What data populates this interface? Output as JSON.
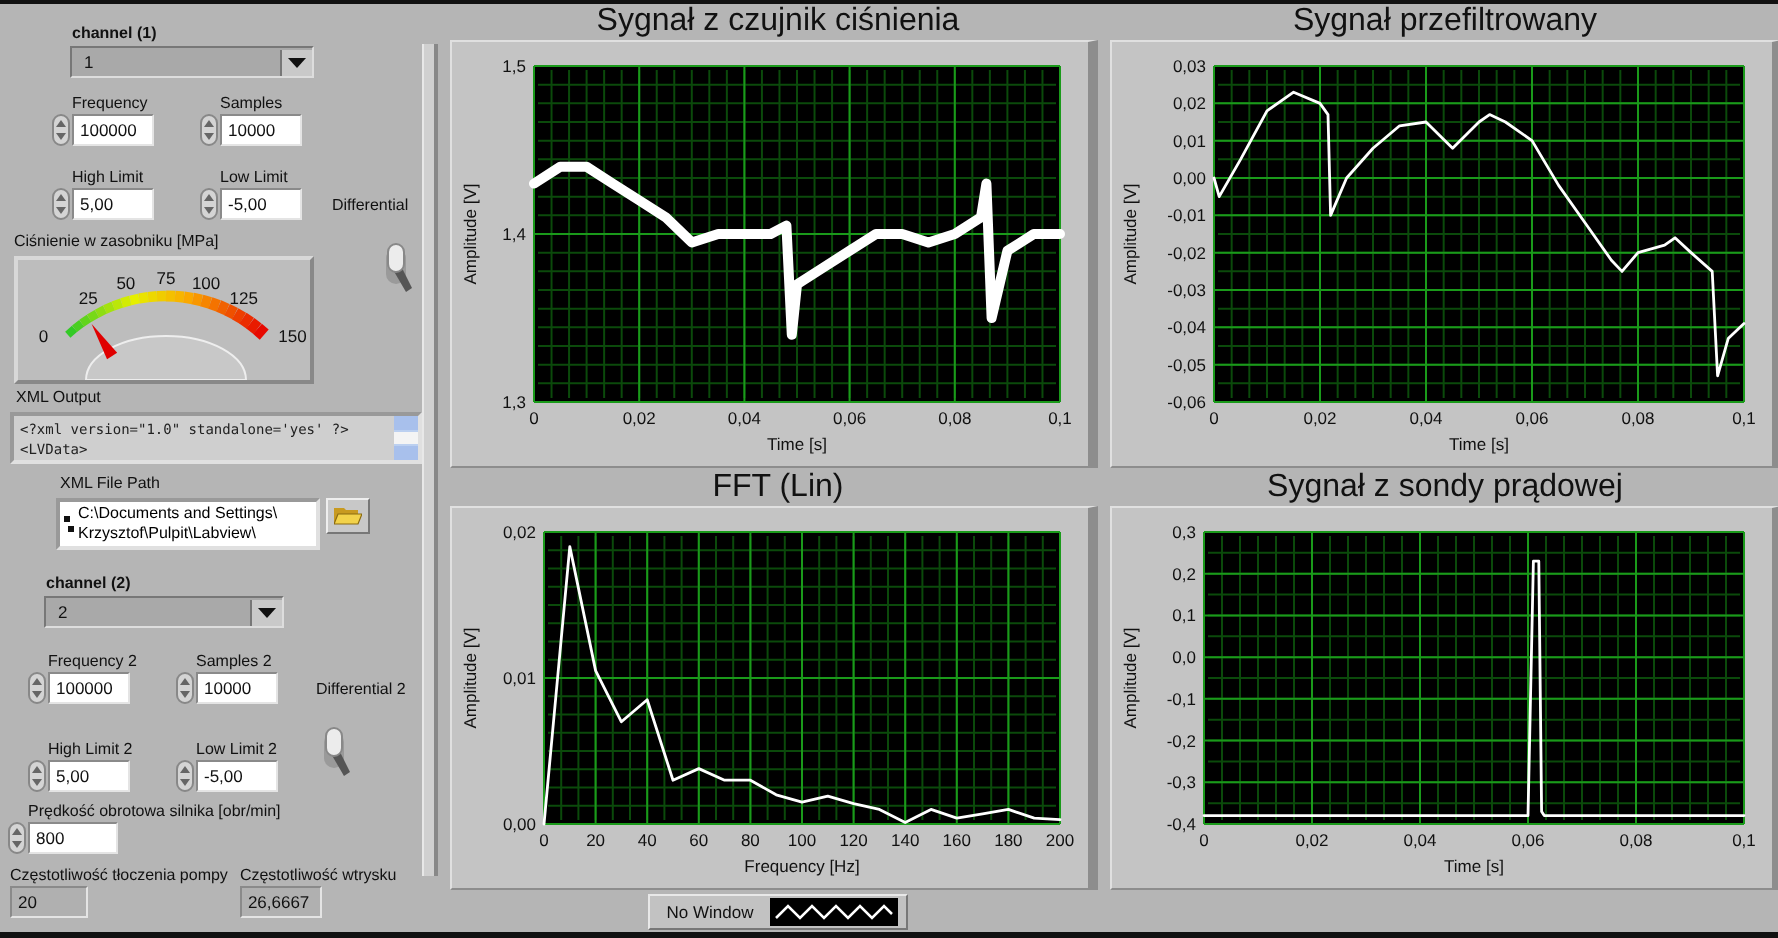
{
  "left_panel": {
    "channel_1": {
      "label": "channel (1)",
      "value": "1",
      "inputs": [
        {
          "label": "Frequency",
          "value": "100000"
        },
        {
          "label": "Samples",
          "value": "10000"
        },
        {
          "label": "High Limit",
          "value": "5,00"
        },
        {
          "label": "Low Limit",
          "value": "-5,00"
        }
      ],
      "differential": {
        "label": "Differential",
        "on": false
      }
    },
    "gauge": {
      "label": "Ciśnienie w zasobniku [MPa]",
      "scale": [
        "0",
        "25",
        "50",
        "75",
        "100",
        "125",
        "150"
      ],
      "level": 0.12
    },
    "xml_output": {
      "label": "XML Output",
      "lines": [
        "<?xml version=\"1.0\" standalone='yes' ?>",
        "<LVData>"
      ]
    },
    "xml_file_path": {
      "label": "XML File Path",
      "lines": [
        "C:\\Documents and Settings\\",
        "Krzysztof\\Pulpit\\Labview\\"
      ]
    },
    "channel_2": {
      "label": "channel (2)",
      "value": "2",
      "inputs": [
        {
          "label": "Frequency 2",
          "value": "100000"
        },
        {
          "label": "Samples 2",
          "value": "10000"
        },
        {
          "label": "High Limit 2",
          "value": "5,00"
        },
        {
          "label": "Low Limit 2",
          "value": "-5,00"
        }
      ],
      "differential": {
        "label": "Differential 2",
        "on": false
      }
    },
    "motor_speed": {
      "label": "Prędkość obrotowa silnika [obr/min]",
      "value": "800"
    },
    "indicators": [
      {
        "label": "Częstotliwość tłoczenia pompy",
        "value": "20"
      },
      {
        "label": "Częstotliwość wtrysku",
        "value": "26,6667"
      }
    ]
  },
  "graphs": [
    {
      "title": "Sygnał z czujnik ciśnienia",
      "kind": "noisy",
      "chart_data": {
        "type": "line",
        "grid": true,
        "xlabel": "Time [s]",
        "ylabel": "Amplitude [V]",
        "xlim": [
          0,
          0.1
        ],
        "ylim": [
          1.3,
          1.5
        ],
        "xticks": [
          {
            "value": 0,
            "label": "0"
          },
          {
            "value": 0.02,
            "label": "0,02"
          },
          {
            "value": 0.04,
            "label": "0,04"
          },
          {
            "value": 0.06,
            "label": "0,06"
          },
          {
            "value": 0.08,
            "label": "0,08"
          },
          {
            "value": 0.1,
            "label": "0,1"
          }
        ],
        "yticks": [
          {
            "value": 1.3,
            "label": "1,3"
          },
          {
            "value": 1.4,
            "label": "1,4"
          },
          {
            "value": 1.5,
            "label": "1,5"
          }
        ],
        "x": [
          0,
          0.005,
          0.01,
          0.015,
          0.02,
          0.025,
          0.03,
          0.035,
          0.04,
          0.045,
          0.048,
          0.049,
          0.05,
          0.055,
          0.06,
          0.065,
          0.07,
          0.075,
          0.08,
          0.085,
          0.086,
          0.087,
          0.09,
          0.095,
          0.1
        ],
        "series": [
          {
            "color": "#ffffff",
            "values": [
              1.43,
              1.44,
              1.44,
              1.43,
              1.42,
              1.41,
              1.395,
              1.4,
              1.4,
              1.4,
              1.405,
              1.34,
              1.37,
              1.38,
              1.39,
              1.4,
              1.4,
              1.395,
              1.4,
              1.41,
              1.43,
              1.35,
              1.39,
              1.4,
              1.4
            ]
          }
        ]
      }
    },
    {
      "title": "Sygnał przefiltrowany",
      "kind": "line",
      "chart_data": {
        "type": "line",
        "grid": true,
        "xlabel": "Time [s]",
        "ylabel": "Amplitude [V]",
        "xlim": [
          0,
          0.1
        ],
        "ylim": [
          -0.06,
          0.03
        ],
        "xticks": [
          {
            "value": 0,
            "label": "0"
          },
          {
            "value": 0.02,
            "label": "0,02"
          },
          {
            "value": 0.04,
            "label": "0,04"
          },
          {
            "value": 0.06,
            "label": "0,06"
          },
          {
            "value": 0.08,
            "label": "0,08"
          },
          {
            "value": 0.1,
            "label": "0,1"
          }
        ],
        "yticks": [
          {
            "value": 0.03,
            "label": "0,03"
          },
          {
            "value": 0.02,
            "label": "0,02"
          },
          {
            "value": 0.01,
            "label": "0,01"
          },
          {
            "value": 0,
            "label": "0,00"
          },
          {
            "value": -0.01,
            "label": "-0,01"
          },
          {
            "value": -0.02,
            "label": "-0,02"
          },
          {
            "value": -0.03,
            "label": "-0,03"
          },
          {
            "value": -0.04,
            "label": "-0,04"
          },
          {
            "value": -0.05,
            "label": "-0,05"
          },
          {
            "value": -0.06,
            "label": "-0,06"
          }
        ],
        "x": [
          0,
          0.001,
          0.005,
          0.01,
          0.015,
          0.02,
          0.0215,
          0.022,
          0.025,
          0.03,
          0.035,
          0.04,
          0.045,
          0.05,
          0.052,
          0.055,
          0.06,
          0.065,
          0.07,
          0.075,
          0.077,
          0.08,
          0.085,
          0.087,
          0.09,
          0.094,
          0.095,
          0.097,
          0.1
        ],
        "series": [
          {
            "color": "#ffffff",
            "values": [
              0,
              -0.005,
              0.005,
              0.018,
              0.023,
              0.02,
              0.017,
              -0.01,
              0,
              0.008,
              0.014,
              0.015,
              0.008,
              0.015,
              0.017,
              0.015,
              0.01,
              -0.002,
              -0.012,
              -0.022,
              -0.025,
              -0.02,
              -0.018,
              -0.016,
              -0.02,
              -0.025,
              -0.053,
              -0.043,
              -0.039
            ]
          }
        ]
      }
    },
    {
      "title": "FFT  (Lin)",
      "kind": "line",
      "window_selector": {
        "label": "No Window"
      },
      "chart_data": {
        "type": "line",
        "grid": true,
        "xlabel": "Frequency [Hz]",
        "ylabel": "Amplitude [V]",
        "xlim": [
          0,
          200
        ],
        "ylim": [
          0,
          0.02
        ],
        "xticks": [
          0,
          20,
          40,
          60,
          80,
          100,
          120,
          140,
          160,
          180,
          200
        ],
        "yticks": [
          {
            "value": 0,
            "label": "0,00"
          },
          {
            "value": 0.01,
            "label": "0,01"
          },
          {
            "value": 0.02,
            "label": "0,02"
          }
        ],
        "x": [
          0,
          10,
          20,
          30,
          40,
          50,
          60,
          70,
          80,
          90,
          100,
          110,
          120,
          130,
          140,
          150,
          160,
          170,
          180,
          190,
          200
        ],
        "series": [
          {
            "color": "#ffffff",
            "values": [
              0,
              0.019,
              0.0105,
              0.007,
              0.0085,
              0.003,
              0.0038,
              0.003,
              0.003,
              0.002,
              0.0015,
              0.0019,
              0.0014,
              0.001,
              0.0001,
              0.001,
              0.0004,
              0.0007,
              0.001,
              0.0004,
              0.0003
            ]
          }
        ]
      }
    },
    {
      "title": "Sygnał z sondy prądowej",
      "kind": "line",
      "chart_data": {
        "type": "line",
        "grid": true,
        "xlabel": "Time [s]",
        "ylabel": "Amplitude [V]",
        "xlim": [
          0,
          0.1
        ],
        "ylim": [
          -0.4,
          0.3
        ],
        "xticks": [
          {
            "value": 0,
            "label": "0"
          },
          {
            "value": 0.02,
            "label": "0,02"
          },
          {
            "value": 0.04,
            "label": "0,04"
          },
          {
            "value": 0.06,
            "label": "0,06"
          },
          {
            "value": 0.08,
            "label": "0,08"
          },
          {
            "value": 0.1,
            "label": "0,1"
          }
        ],
        "yticks": [
          {
            "value": 0.3,
            "label": "0,3"
          },
          {
            "value": 0.2,
            "label": "0,2"
          },
          {
            "value": 0.1,
            "label": "0,1"
          },
          {
            "value": 0,
            "label": "0,0"
          },
          {
            "value": -0.1,
            "label": "-0,1"
          },
          {
            "value": -0.2,
            "label": "-0,2"
          },
          {
            "value": -0.3,
            "label": "-0,3"
          },
          {
            "value": -0.4,
            "label": "-0,4"
          }
        ],
        "x": [
          0,
          0.06,
          0.061,
          0.062,
          0.0625,
          0.063,
          0.1
        ],
        "series": [
          {
            "color": "#ffffff",
            "values": [
              -0.38,
              -0.38,
              0.23,
              0.23,
              -0.37,
              -0.38,
              -0.38
            ]
          }
        ]
      }
    }
  ]
}
